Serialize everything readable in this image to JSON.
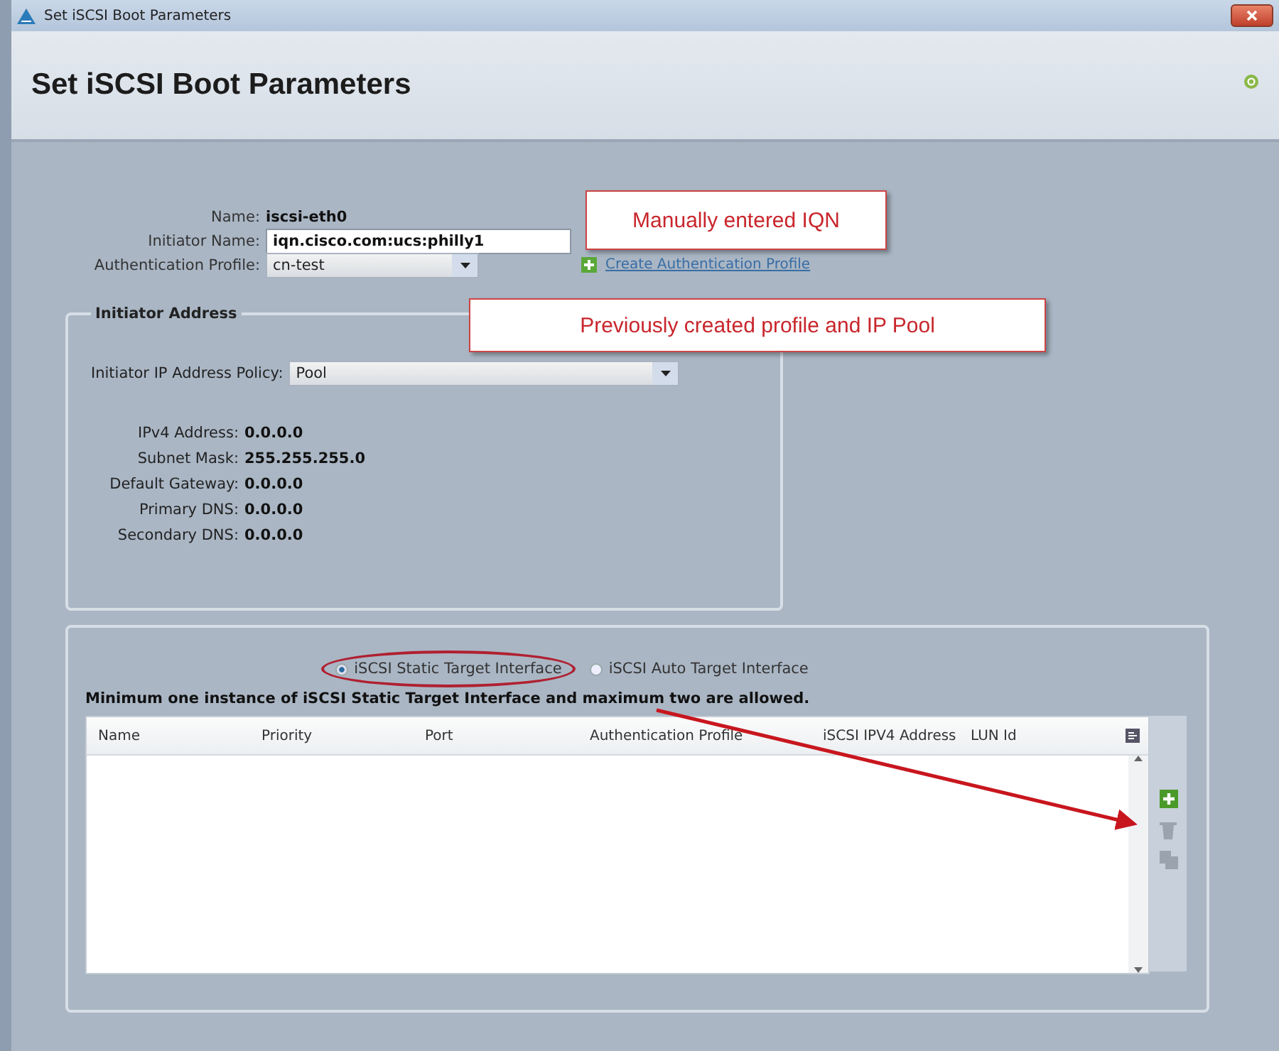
{
  "window": {
    "title": "Set iSCSI Boot Parameters"
  },
  "header": {
    "title": "Set iSCSI Boot Parameters"
  },
  "form": {
    "name": {
      "label": "Name:",
      "value": "iscsi-eth0"
    },
    "initiator_name": {
      "label": "Initiator Name:",
      "value": "iqn.cisco.com:ucs:philly1"
    },
    "authentication_profile": {
      "label": "Authentication Profile:",
      "value": "cn-test"
    },
    "create_link": "Create Authentication Profile"
  },
  "initiator_address": {
    "title": "Initiator Address",
    "policy": {
      "label": "Initiator IP Address Policy:",
      "value": "Pool"
    },
    "fields": [
      {
        "label": "IPv4 Address:",
        "value": "0.0.0.0"
      },
      {
        "label": "Subnet Mask:",
        "value": "255.255.255.0"
      },
      {
        "label": "Default Gateway:",
        "value": "0.0.0.0"
      },
      {
        "label": "Primary DNS:",
        "value": "0.0.0.0"
      },
      {
        "label": "Secondary DNS:",
        "value": "0.0.0.0"
      }
    ]
  },
  "target": {
    "options": [
      {
        "label": "iSCSI Static Target Interface",
        "selected": true,
        "highlighted": true
      },
      {
        "label": "iSCSI Auto Target Interface",
        "selected": false,
        "highlighted": false
      }
    ],
    "note": "Minimum one instance of iSCSI Static Target Interface and maximum two are allowed.",
    "table": {
      "columns": [
        "Name",
        "Priority",
        "Port",
        "Authentication Profile",
        "iSCSI IPV4 Address",
        "LUN Id"
      ]
    },
    "actions": [
      {
        "kind": "add",
        "disabled": false
      },
      {
        "kind": "delete",
        "disabled": true
      },
      {
        "kind": "properties",
        "disabled": true
      }
    ]
  },
  "callouts": [
    {
      "text": "Manually entered IQN"
    },
    {
      "text": "Previously created profile and IP Pool"
    }
  ]
}
